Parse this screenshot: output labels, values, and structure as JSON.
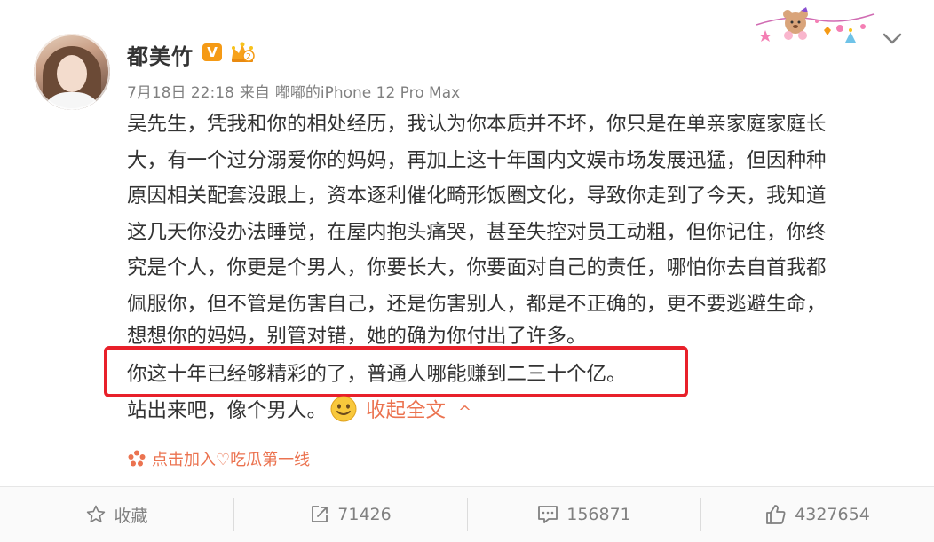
{
  "post": {
    "username": "都美竹",
    "verified_badge": "V",
    "meta": {
      "time": "7月18日 22:18",
      "source_prefix": "来自",
      "source": "嘟嘟的iPhone 12 Pro Max"
    },
    "lines": [
      "吴先生，凭我和你的相处经历，我认为你本质并不坏，你只是在单亲家庭家庭长",
      "大，有一个过分溺爱你的妈妈，再加上这十年国内文娱市场发展迅猛，但因种种",
      "原因相关配套没跟上，资本逐利催化畸形饭圈文化，导致你走到了今天，我知道",
      "这几天你没办法睡觉，在屋内抱头痛哭，甚至失控对员工动粗，但你记住，你终",
      "究是个人，你更是个男人，你要长大，你要面对自己的责任，哪怕你去自首我都",
      "佩服你，但不管是伤害自己，还是伤害别人，都是不正确的，更不要逃避生命，",
      "想想你的妈妈，别管对错，她的确为你付出了许多。",
      "你这十年已经够精彩的了，普通人哪能赚到二三十个亿。"
    ],
    "last_line": "站出来吧，像个男人。",
    "collapse_label": "收起全文",
    "collapse_caret": "^",
    "group_link": "点击加入♡吃瓜第一线"
  },
  "colors": {
    "highlight_border": "#e8202a",
    "link": "#eb7350",
    "verified": "#f59a15"
  },
  "footer": {
    "favorite_label": "收藏",
    "repost_count": "71426",
    "comment_count": "156871",
    "like_count": "4327654"
  },
  "icons": [
    "chevron-down-icon",
    "star-icon",
    "repost-icon",
    "comment-icon",
    "like-icon",
    "smiley-icon",
    "flower-icon",
    "crown-badge-icon"
  ]
}
